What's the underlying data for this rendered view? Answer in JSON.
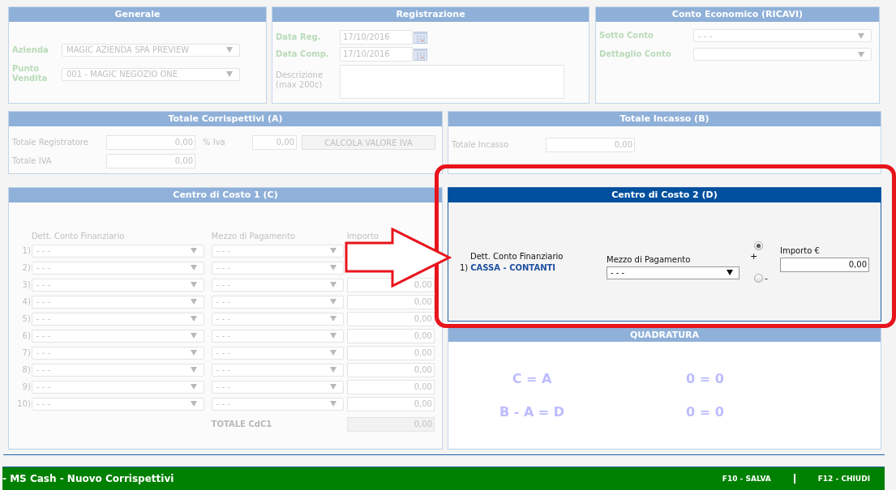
{
  "generale": {
    "title": "Generale",
    "fields": [
      {
        "label": "Azienda",
        "value": "MAGIC AZIENDA SPA PREVIEW"
      },
      {
        "label": "Punto Vendita",
        "value": "001 - MAGIC NEGOZIO ONE"
      }
    ]
  },
  "registrazione": {
    "title": "Registrazione",
    "dates": [
      {
        "label": "Data Reg.",
        "value": "17/10/2016"
      },
      {
        "label": "Data Comp.",
        "value": "17/10/2016"
      }
    ],
    "descrizione": {
      "label": "Descrizione (max 200c)"
    }
  },
  "conto_economico": {
    "title": "Conto Economico (RICAVI)",
    "fields": [
      {
        "label": "Sotto Conto",
        "value": "- - -"
      },
      {
        "label": "Dettaglio Conto"
      }
    ]
  },
  "totale_corrispettivi": {
    "title": "Totale Corrispettivi (A)",
    "totale_registratore": {
      "label": "Totale Registratore",
      "value": "0,00"
    },
    "iva": {
      "label": "% Iva",
      "value": "0,00"
    },
    "button": "CALCOLA VALORE IVA",
    "totale_iva": {
      "label": "Totale IVA",
      "value": "0,00"
    }
  },
  "totale_incasso": {
    "title": "Totale Incasso (B)",
    "label": "Totale Incasso",
    "value": "0,00"
  },
  "centro_costo_1": {
    "title": "Centro di Costo 1 (C)",
    "columns": [
      "Dett. Conto Finanziario",
      "Mezzo di Pagamento",
      "Importo"
    ],
    "rows": [
      {
        "index": "1)",
        "conto": "- - -",
        "mezzo": "- - -"
      },
      {
        "index": "2)",
        "conto": "- - -",
        "mezzo": "- - -"
      },
      {
        "index": "3)",
        "conto": "- - -",
        "mezzo": "- - -",
        "importo": "0,00"
      },
      {
        "index": "4)",
        "conto": "- - -",
        "mezzo": "- - -",
        "importo": "0,00"
      },
      {
        "index": "5)",
        "conto": "- - -",
        "mezzo": "- - -",
        "importo": "0,00"
      },
      {
        "index": "6)",
        "conto": "- - -",
        "mezzo": "- - -",
        "importo": "0,00"
      },
      {
        "index": "7)",
        "conto": "- - -",
        "mezzo": "- - -",
        "importo": "0,00"
      },
      {
        "index": "8)",
        "conto": "- - -",
        "mezzo": "- - -",
        "importo": "0,00"
      },
      {
        "index": "9)",
        "conto": "- - -",
        "mezzo": "- - -",
        "importo": "0,00"
      },
      {
        "index": "10)",
        "conto": "- - -",
        "mezzo": "- - -",
        "importo": "0,00"
      }
    ],
    "total": {
      "label": "TOTALE CdC1",
      "value": "0,00"
    }
  },
  "centro_costo_2": {
    "title": "Centro di Costo 2 (D)",
    "conto_label": "Dett. Conto Finanziario",
    "index": "1)",
    "conto": "CASSA - CONTANTI",
    "mezzo_label": "Mezzo di Pagamento",
    "mezzo": "- - -",
    "signs": [
      {
        "label": "+",
        "selected": true
      },
      {
        "label": "-",
        "selected": false
      }
    ],
    "importo_label": "Importo €",
    "importo": "0,00"
  },
  "quadratura": {
    "title": "QUADRATURA",
    "rows": [
      {
        "formula": "C = A",
        "result": "0 = 0"
      },
      {
        "formula": "B - A = D",
        "result": "0 = 0"
      }
    ]
  },
  "footer": {
    "title": "- MS Cash - Nuovo Corrispettivi",
    "actions": [
      "F10 - SALVA",
      "F12 - CHIUDI"
    ]
  }
}
